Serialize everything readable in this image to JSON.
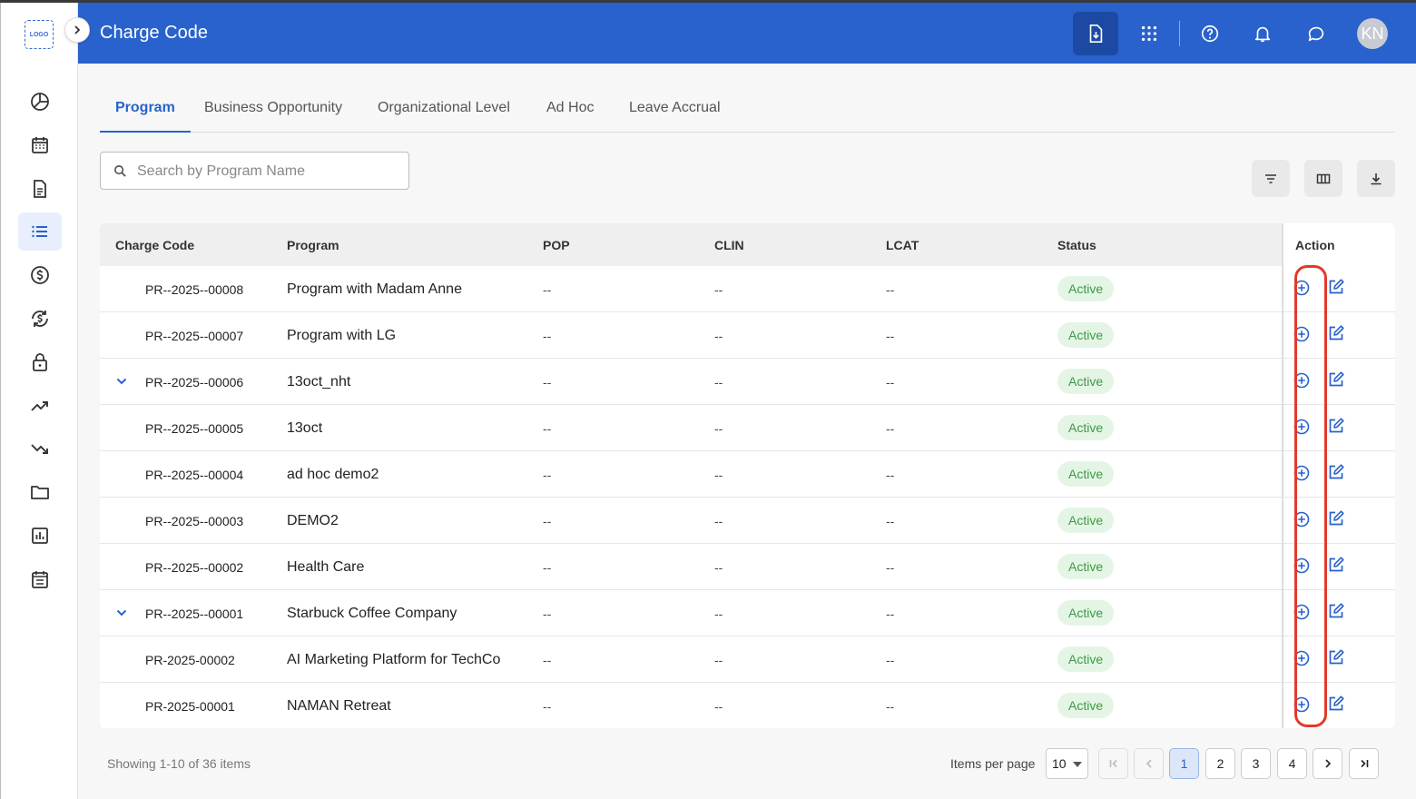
{
  "app": {
    "logo_text": "LOGO",
    "title": "Charge Code",
    "avatar_initials": "KN"
  },
  "header_icons": [
    "download-document-icon",
    "apps-grid-icon",
    "help-icon",
    "bell-icon",
    "chat-icon"
  ],
  "sidebar": {
    "items": [
      {
        "icon": "pie-chart-icon"
      },
      {
        "icon": "calendar-icon"
      },
      {
        "icon": "document-icon"
      },
      {
        "icon": "list-icon",
        "active": true
      },
      {
        "icon": "dollar-icon"
      },
      {
        "icon": "currency-exchange-icon"
      },
      {
        "icon": "lock-icon"
      },
      {
        "icon": "trending-up-icon"
      },
      {
        "icon": "trending-down-icon"
      },
      {
        "icon": "folder-icon"
      },
      {
        "icon": "bar-report-icon"
      },
      {
        "icon": "schedule-icon"
      }
    ]
  },
  "tabs": [
    {
      "label": "Program",
      "active": true
    },
    {
      "label": "Business Opportunity"
    },
    {
      "label": "Organizational Level"
    },
    {
      "label": "Ad Hoc"
    },
    {
      "label": "Leave Accrual"
    }
  ],
  "search": {
    "placeholder": "Search by Program Name",
    "value": ""
  },
  "toolbar_icons": [
    "filter-icon",
    "columns-icon",
    "download-icon"
  ],
  "table": {
    "columns": [
      "Charge Code",
      "Program",
      "POP",
      "CLIN",
      "LCAT",
      "Status",
      "Action"
    ],
    "rows": [
      {
        "code": "PR--2025--00008",
        "program": "Program with Madam Anne",
        "pop": "--",
        "clin": "--",
        "lcat": "--",
        "status": "Active",
        "expandable": false
      },
      {
        "code": "PR--2025--00007",
        "program": "Program with LG",
        "pop": "--",
        "clin": "--",
        "lcat": "--",
        "status": "Active",
        "expandable": false
      },
      {
        "code": "PR--2025--00006",
        "program": "13oct_nht",
        "pop": "--",
        "clin": "--",
        "lcat": "--",
        "status": "Active",
        "expandable": true
      },
      {
        "code": "PR--2025--00005",
        "program": "13oct",
        "pop": "--",
        "clin": "--",
        "lcat": "--",
        "status": "Active",
        "expandable": false
      },
      {
        "code": "PR--2025--00004",
        "program": "ad hoc demo2",
        "pop": "--",
        "clin": "--",
        "lcat": "--",
        "status": "Active",
        "expandable": false
      },
      {
        "code": "PR--2025--00003",
        "program": "DEMO2",
        "pop": "--",
        "clin": "--",
        "lcat": "--",
        "status": "Active",
        "expandable": false
      },
      {
        "code": "PR--2025--00002",
        "program": "Health Care",
        "pop": "--",
        "clin": "--",
        "lcat": "--",
        "status": "Active",
        "expandable": false
      },
      {
        "code": "PR--2025--00001",
        "program": "Starbuck Coffee Company",
        "pop": "--",
        "clin": "--",
        "lcat": "--",
        "status": "Active",
        "expandable": true
      },
      {
        "code": "PR-2025-00002",
        "program": "AI Marketing Platform for TechCo",
        "pop": "--",
        "clin": "--",
        "lcat": "--",
        "status": "Active",
        "expandable": false
      },
      {
        "code": "PR-2025-00001",
        "program": "NAMAN Retreat",
        "pop": "--",
        "clin": "--",
        "lcat": "--",
        "status": "Active",
        "expandable": false
      }
    ]
  },
  "footer": {
    "showing": "Showing 1-10 of 36 items",
    "items_per_page_label": "Items per page",
    "items_per_page": "10",
    "pages": [
      "1",
      "2",
      "3",
      "4"
    ],
    "current_page": "1"
  },
  "colors": {
    "brand": "#2962cc",
    "active_badge_bg": "#e4f5e5",
    "active_badge_text": "#3c9a44",
    "highlight": "#e23a2a"
  }
}
